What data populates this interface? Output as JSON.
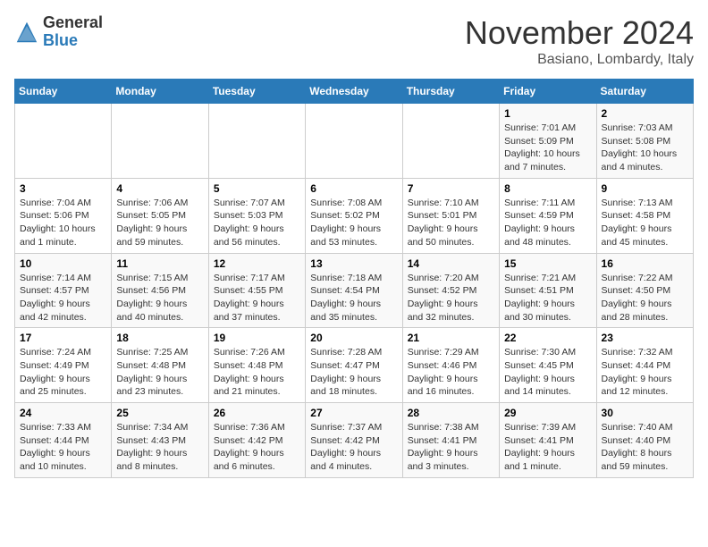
{
  "header": {
    "logo_line1": "General",
    "logo_line2": "Blue",
    "month_title": "November 2024",
    "location": "Basiano, Lombardy, Italy"
  },
  "days_of_week": [
    "Sunday",
    "Monday",
    "Tuesday",
    "Wednesday",
    "Thursday",
    "Friday",
    "Saturday"
  ],
  "weeks": [
    [
      {
        "day": "",
        "info": ""
      },
      {
        "day": "",
        "info": ""
      },
      {
        "day": "",
        "info": ""
      },
      {
        "day": "",
        "info": ""
      },
      {
        "day": "",
        "info": ""
      },
      {
        "day": "1",
        "info": "Sunrise: 7:01 AM\nSunset: 5:09 PM\nDaylight: 10 hours and 7 minutes."
      },
      {
        "day": "2",
        "info": "Sunrise: 7:03 AM\nSunset: 5:08 PM\nDaylight: 10 hours and 4 minutes."
      }
    ],
    [
      {
        "day": "3",
        "info": "Sunrise: 7:04 AM\nSunset: 5:06 PM\nDaylight: 10 hours and 1 minute."
      },
      {
        "day": "4",
        "info": "Sunrise: 7:06 AM\nSunset: 5:05 PM\nDaylight: 9 hours and 59 minutes."
      },
      {
        "day": "5",
        "info": "Sunrise: 7:07 AM\nSunset: 5:03 PM\nDaylight: 9 hours and 56 minutes."
      },
      {
        "day": "6",
        "info": "Sunrise: 7:08 AM\nSunset: 5:02 PM\nDaylight: 9 hours and 53 minutes."
      },
      {
        "day": "7",
        "info": "Sunrise: 7:10 AM\nSunset: 5:01 PM\nDaylight: 9 hours and 50 minutes."
      },
      {
        "day": "8",
        "info": "Sunrise: 7:11 AM\nSunset: 4:59 PM\nDaylight: 9 hours and 48 minutes."
      },
      {
        "day": "9",
        "info": "Sunrise: 7:13 AM\nSunset: 4:58 PM\nDaylight: 9 hours and 45 minutes."
      }
    ],
    [
      {
        "day": "10",
        "info": "Sunrise: 7:14 AM\nSunset: 4:57 PM\nDaylight: 9 hours and 42 minutes."
      },
      {
        "day": "11",
        "info": "Sunrise: 7:15 AM\nSunset: 4:56 PM\nDaylight: 9 hours and 40 minutes."
      },
      {
        "day": "12",
        "info": "Sunrise: 7:17 AM\nSunset: 4:55 PM\nDaylight: 9 hours and 37 minutes."
      },
      {
        "day": "13",
        "info": "Sunrise: 7:18 AM\nSunset: 4:54 PM\nDaylight: 9 hours and 35 minutes."
      },
      {
        "day": "14",
        "info": "Sunrise: 7:20 AM\nSunset: 4:52 PM\nDaylight: 9 hours and 32 minutes."
      },
      {
        "day": "15",
        "info": "Sunrise: 7:21 AM\nSunset: 4:51 PM\nDaylight: 9 hours and 30 minutes."
      },
      {
        "day": "16",
        "info": "Sunrise: 7:22 AM\nSunset: 4:50 PM\nDaylight: 9 hours and 28 minutes."
      }
    ],
    [
      {
        "day": "17",
        "info": "Sunrise: 7:24 AM\nSunset: 4:49 PM\nDaylight: 9 hours and 25 minutes."
      },
      {
        "day": "18",
        "info": "Sunrise: 7:25 AM\nSunset: 4:48 PM\nDaylight: 9 hours and 23 minutes."
      },
      {
        "day": "19",
        "info": "Sunrise: 7:26 AM\nSunset: 4:48 PM\nDaylight: 9 hours and 21 minutes."
      },
      {
        "day": "20",
        "info": "Sunrise: 7:28 AM\nSunset: 4:47 PM\nDaylight: 9 hours and 18 minutes."
      },
      {
        "day": "21",
        "info": "Sunrise: 7:29 AM\nSunset: 4:46 PM\nDaylight: 9 hours and 16 minutes."
      },
      {
        "day": "22",
        "info": "Sunrise: 7:30 AM\nSunset: 4:45 PM\nDaylight: 9 hours and 14 minutes."
      },
      {
        "day": "23",
        "info": "Sunrise: 7:32 AM\nSunset: 4:44 PM\nDaylight: 9 hours and 12 minutes."
      }
    ],
    [
      {
        "day": "24",
        "info": "Sunrise: 7:33 AM\nSunset: 4:44 PM\nDaylight: 9 hours and 10 minutes."
      },
      {
        "day": "25",
        "info": "Sunrise: 7:34 AM\nSunset: 4:43 PM\nDaylight: 9 hours and 8 minutes."
      },
      {
        "day": "26",
        "info": "Sunrise: 7:36 AM\nSunset: 4:42 PM\nDaylight: 9 hours and 6 minutes."
      },
      {
        "day": "27",
        "info": "Sunrise: 7:37 AM\nSunset: 4:42 PM\nDaylight: 9 hours and 4 minutes."
      },
      {
        "day": "28",
        "info": "Sunrise: 7:38 AM\nSunset: 4:41 PM\nDaylight: 9 hours and 3 minutes."
      },
      {
        "day": "29",
        "info": "Sunrise: 7:39 AM\nSunset: 4:41 PM\nDaylight: 9 hours and 1 minute."
      },
      {
        "day": "30",
        "info": "Sunrise: 7:40 AM\nSunset: 4:40 PM\nDaylight: 8 hours and 59 minutes."
      }
    ]
  ]
}
